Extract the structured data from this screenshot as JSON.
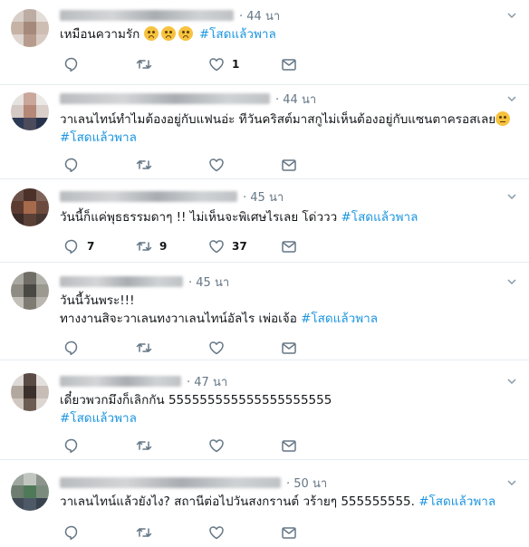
{
  "colors": {
    "hashtag": "#1b95e0",
    "muted": "#657786",
    "divider": "#e6ecf0"
  },
  "action_icons": [
    "reply-icon",
    "retweet-icon",
    "like-icon",
    "direct-message-icon"
  ],
  "tweets": [
    {
      "time": "· 44 นา",
      "text": "เหมือนความรัก",
      "emoji": "face-anxious-icon",
      "hashtag": "#โสดแล้วพาล",
      "reply_count": "",
      "retweet_count": "",
      "like_count": "1"
    },
    {
      "time": "· 44 นา",
      "text": "วาเลนไทน์ทำไมต้องอยู่กับแฟนอ่ะ ทีวันคริสต์มาสกูไม่เห็นต้องอยู่กับแซนตาครอสเลย",
      "emoji": "face-thinking-icon",
      "hashtag": "#โสดแล้วพาล",
      "reply_count": "",
      "retweet_count": "",
      "like_count": ""
    },
    {
      "time": "· 45 นา",
      "text": "วันนี้ก็แค่พุธธรรมดาๆ !! ไม่เห็นจะพิเศษไรเลย โด่ววว",
      "hashtag": "#โสดแล้วพาล",
      "reply_count": "7",
      "retweet_count": "9",
      "like_count": "37"
    },
    {
      "time": "· 45 นา",
      "line1": "วันนี้วันพระ!!!",
      "text": "ทางงานสิจะวาเลนทงวาเลนไทน์อัลไร เพ่อเจ้อ",
      "hashtag": "#โสดแล้วพาล",
      "reply_count": "",
      "retweet_count": "",
      "like_count": ""
    },
    {
      "time": "· 47 นา",
      "text": "เดี๋ยวพวกมึงก็เลิกกัน 555555555555555555555",
      "hashtag": "#โสดแล้วพาล",
      "reply_count": "",
      "retweet_count": "",
      "like_count": ""
    },
    {
      "time": "· 50 นา",
      "text": "วาเลนไทน์แล้วยังไง?  สถานีต่อไปวันสงกรานต์ วร้ายๆ 555555555.",
      "hashtag": "#โสดแล้วพาล",
      "reply_count": "",
      "retweet_count": "",
      "like_count": ""
    }
  ]
}
